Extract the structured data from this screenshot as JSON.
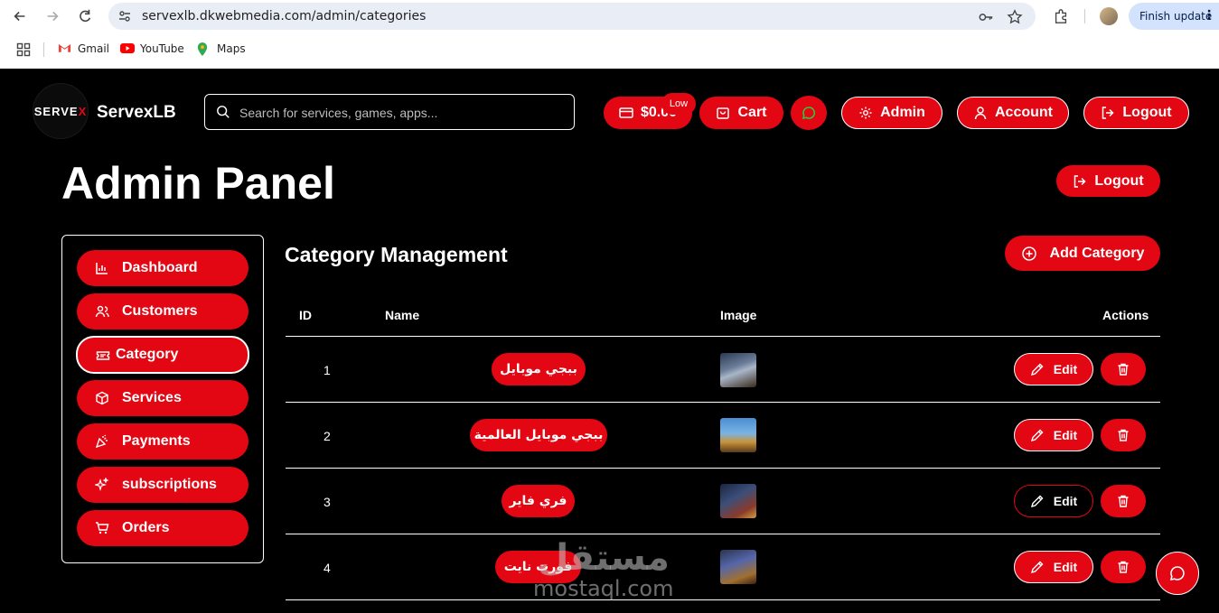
{
  "browser": {
    "url": "servexlb.dkwebmedia.com/admin/categories",
    "finish_update": "Finish update",
    "bookmarks": [
      {
        "label": "Gmail",
        "icon": "gmail-icon"
      },
      {
        "label": "YouTube",
        "icon": "youtube-icon"
      },
      {
        "label": "Maps",
        "icon": "maps-icon"
      }
    ]
  },
  "header": {
    "logo_text": "SERVE",
    "logo_x": "X",
    "brand": "ServexLB",
    "search_placeholder": "Search for services, games, apps...",
    "balance": "$0.00",
    "balance_badge": "Low",
    "cart": "Cart",
    "admin": "Admin",
    "account": "Account",
    "logout": "Logout"
  },
  "page": {
    "title": "Admin Panel",
    "logout": "Logout"
  },
  "sidebar": {
    "items": [
      {
        "label": "Dashboard",
        "icon": "chart-icon",
        "active": false
      },
      {
        "label": "Customers",
        "icon": "users-icon",
        "active": false
      },
      {
        "label": "Category",
        "icon": "ticket-icon",
        "active": true
      },
      {
        "label": "Services",
        "icon": "box-icon",
        "active": false
      },
      {
        "label": "Payments",
        "icon": "party-icon",
        "active": false
      },
      {
        "label": "subscriptions",
        "icon": "sparkles-icon",
        "active": false
      },
      {
        "label": "Orders",
        "icon": "cart-icon",
        "active": false
      }
    ]
  },
  "main": {
    "title": "Category Management",
    "add_button": "Add Category",
    "columns": [
      "ID",
      "Name",
      "Image",
      "Actions"
    ],
    "rows": [
      {
        "id": "1",
        "name": "ببجي موبايل",
        "edit": "Edit"
      },
      {
        "id": "2",
        "name": "ببجي موبايل العالمية",
        "edit": "Edit"
      },
      {
        "id": "3",
        "name": "فري فاير",
        "edit": "Edit"
      },
      {
        "id": "4",
        "name": "فورت نايت",
        "edit": "Edit"
      }
    ]
  },
  "watermark": {
    "arabic": "مستقل",
    "latin": "mostaql.com"
  },
  "colors": {
    "accent": "#e30613",
    "background": "#000000",
    "text": "#ffffff"
  }
}
